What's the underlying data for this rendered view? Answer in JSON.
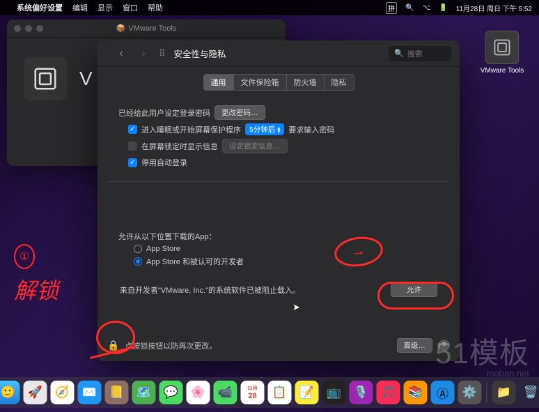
{
  "menubar": {
    "app": "系统偏好设置",
    "items": [
      "编辑",
      "显示",
      "窗口",
      "帮助"
    ],
    "right": {
      "input": "拼",
      "date": "11月28日 周日 下午 5:52"
    }
  },
  "desktop": {
    "vmware_tools": "VMware Tools"
  },
  "vmware_window": {
    "title": "VMware Tools",
    "label_initial": "V"
  },
  "prefs": {
    "title": "安全性与隐私",
    "search_placeholder": "搜索",
    "tabs": [
      "通用",
      "文件保险箱",
      "防火墙",
      "隐私"
    ],
    "active_tab": 0,
    "section1": {
      "line1_pre": "已经给此用户设定登录密码",
      "change_pw_btn": "更改密码…",
      "chk_sleep": "进入睡眠或开始屏幕保护程序",
      "sleep_select": "5分钟后",
      "sleep_after": "要求输入密码",
      "chk_lockmsg": "在屏幕锁定时显示信息",
      "lockmsg_btn": "设定锁定信息…",
      "chk_autologin": "停用自动登录"
    },
    "section2": {
      "allow_title": "允许从以下位置下载的App：",
      "r1": "App Store",
      "r2": "App Store 和被认可的开发者",
      "blocked_text": "来自开发者\"VMware, Inc.\"的系统软件已被阻止载入。",
      "allow_btn": "允许"
    },
    "footer": {
      "lock_text": "点按锁按钮以防再次更改。",
      "advanced_btn": "高级…"
    }
  },
  "annotation": {
    "num": "①",
    "label": "解锁"
  },
  "watermark": {
    "main": "51模板",
    "url": "moban.net"
  }
}
